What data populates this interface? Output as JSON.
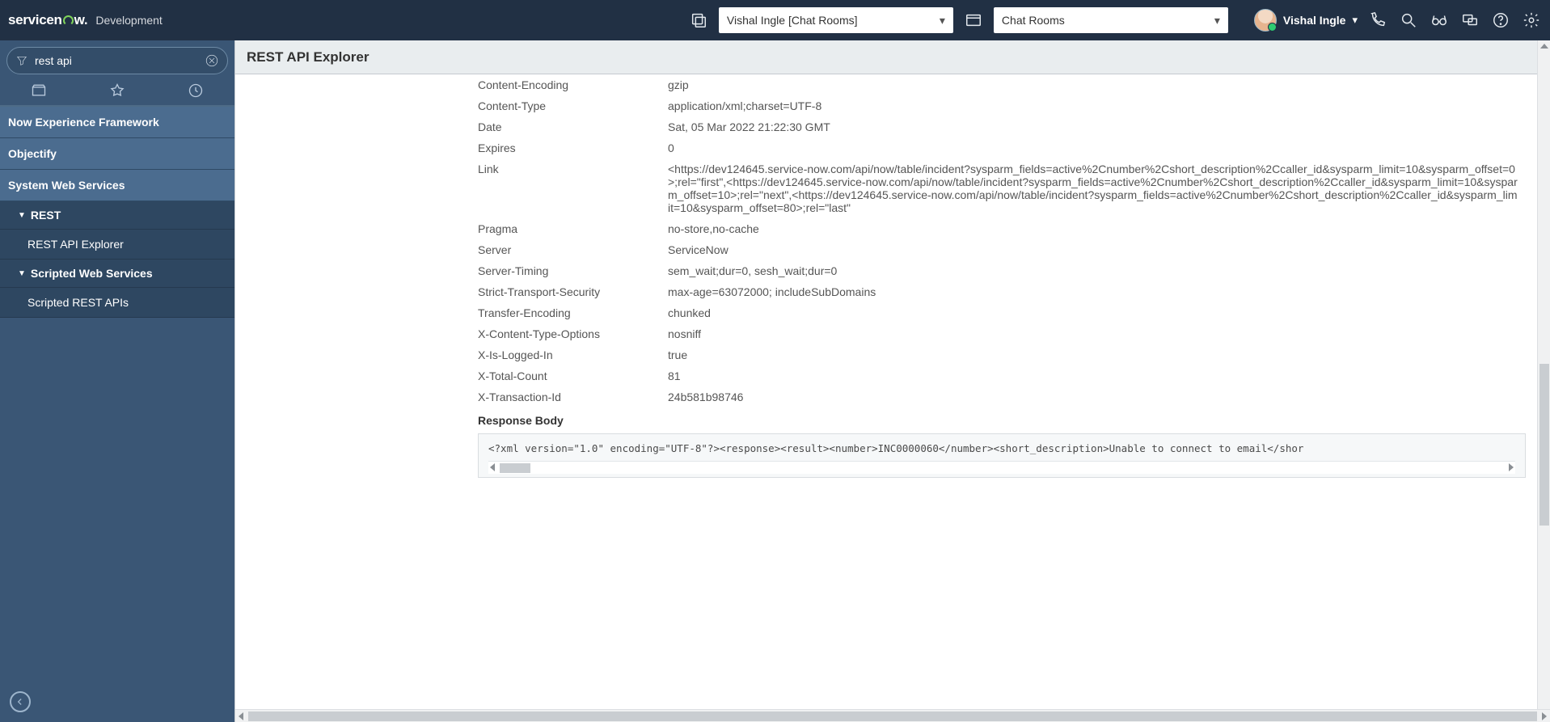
{
  "header": {
    "product": "servicenow",
    "env": "Development",
    "picker1": "Vishal Ingle [Chat Rooms]",
    "picker2": "Chat Rooms",
    "user_name": "Vishal Ingle"
  },
  "sidebar": {
    "filter_value": "rest api",
    "apps": [
      "Now Experience Framework",
      "Objectify",
      "System Web Services"
    ],
    "group_rest": "REST",
    "leaf_rest_explorer": "REST API Explorer",
    "group_scripted": "Scripted Web Services",
    "leaf_scripted_apis": "Scripted REST APIs"
  },
  "main": {
    "title": "REST API Explorer",
    "headers": [
      {
        "name": "Content-Encoding",
        "value": "gzip"
      },
      {
        "name": "Content-Type",
        "value": "application/xml;charset=UTF-8"
      },
      {
        "name": "Date",
        "value": "Sat, 05 Mar 2022 21:22:30 GMT"
      },
      {
        "name": "Expires",
        "value": "0"
      },
      {
        "name": "Link",
        "value": "<https://dev124645.service-now.com/api/now/table/incident?sysparm_fields=active%2Cnumber%2Cshort_description%2Ccaller_id&sysparm_limit=10&sysparm_offset=0>;rel=\"first\",<https://dev124645.service-now.com/api/now/table/incident?sysparm_fields=active%2Cnumber%2Cshort_description%2Ccaller_id&sysparm_limit=10&sysparm_offset=10>;rel=\"next\",<https://dev124645.service-now.com/api/now/table/incident?sysparm_fields=active%2Cnumber%2Cshort_description%2Ccaller_id&sysparm_limit=10&sysparm_offset=80>;rel=\"last\""
      },
      {
        "name": "Pragma",
        "value": "no-store,no-cache"
      },
      {
        "name": "Server",
        "value": "ServiceNow"
      },
      {
        "name": "Server-Timing",
        "value": "sem_wait;dur=0, sesh_wait;dur=0"
      },
      {
        "name": "Strict-Transport-Security",
        "value": "max-age=63072000; includeSubDomains"
      },
      {
        "name": "Transfer-Encoding",
        "value": "chunked"
      },
      {
        "name": "X-Content-Type-Options",
        "value": "nosniff"
      },
      {
        "name": "X-Is-Logged-In",
        "value": "true"
      },
      {
        "name": "X-Total-Count",
        "value": "81"
      },
      {
        "name": "X-Transaction-Id",
        "value": "24b581b98746"
      }
    ],
    "response_body_label": "Response Body",
    "response_body": "<?xml version=\"1.0\" encoding=\"UTF-8\"?><response><result><number>INC0000060</number><short_description>Unable to connect to email</shor"
  }
}
